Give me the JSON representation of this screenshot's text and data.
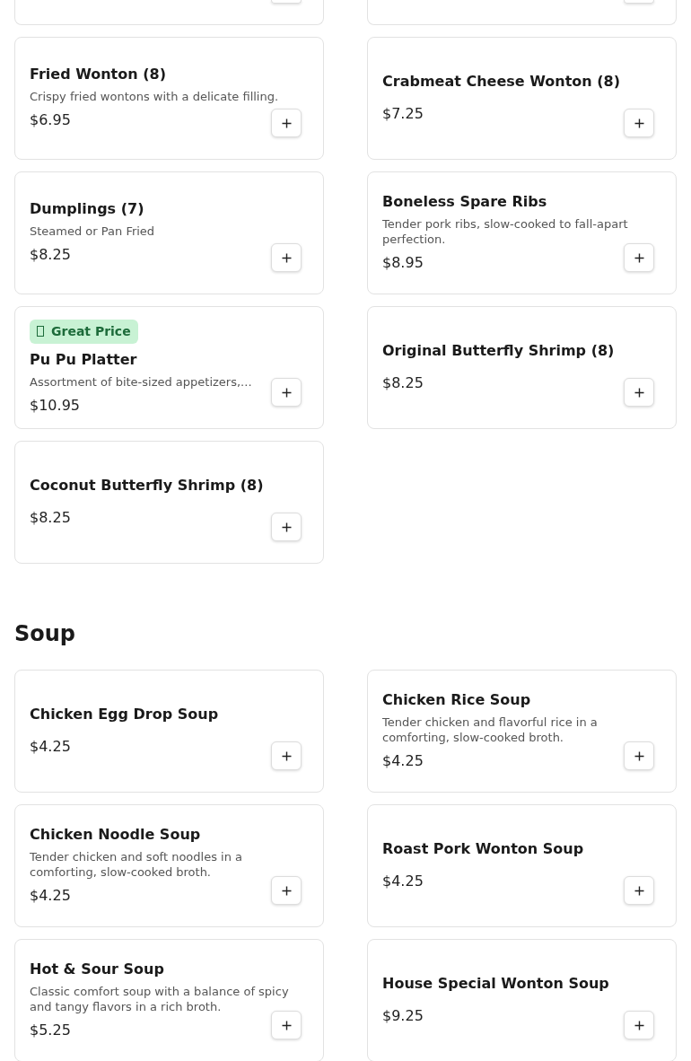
{
  "sections": [
    {
      "cut_above": true,
      "items": [
        {
          "name": "Fried Wonton (8)",
          "description": "Crispy fried wontons with a delicate filling.",
          "price": "$6.95"
        },
        {
          "name": "Crabmeat Cheese Wonton (8)",
          "price": "$7.25"
        },
        {
          "name": "Dumplings (7)",
          "description": "Steamed or Pan Fried",
          "price": "$8.25"
        },
        {
          "name": "Boneless Spare Ribs",
          "description": "Tender pork ribs, slow-cooked to fall-apart perfection.",
          "price": "$8.95"
        },
        {
          "name": "Pu Pu Platter",
          "badge": {
            "label": "Great Price"
          },
          "description": "Assortment of bite-sized appetizers,...",
          "price": "$10.95"
        },
        {
          "name": "Original Butterfly Shrimp (8)",
          "price": "$8.25"
        },
        {
          "name": "Coconut Butterfly Shrimp (8)",
          "price": "$8.25"
        }
      ]
    },
    {
      "title": "Soup",
      "items": [
        {
          "name": "Chicken Egg Drop Soup",
          "price": "$4.25"
        },
        {
          "name": "Chicken Rice Soup",
          "description": "Tender chicken and flavorful rice in a comforting, slow-cooked broth.",
          "price": "$4.25"
        },
        {
          "name": "Chicken Noodle Soup",
          "description": "Tender chicken and soft noodles in a comforting, slow-cooked broth.",
          "price": "$4.25"
        },
        {
          "name": "Roast Pork Wonton Soup",
          "price": "$4.25"
        },
        {
          "name": "Hot & Sour Soup",
          "description": "Classic comfort soup with a balance of spicy and tangy flavors in a rich broth.",
          "price": "$5.25"
        },
        {
          "name": "House Special Wonton Soup",
          "price": "$9.25"
        }
      ]
    }
  ]
}
